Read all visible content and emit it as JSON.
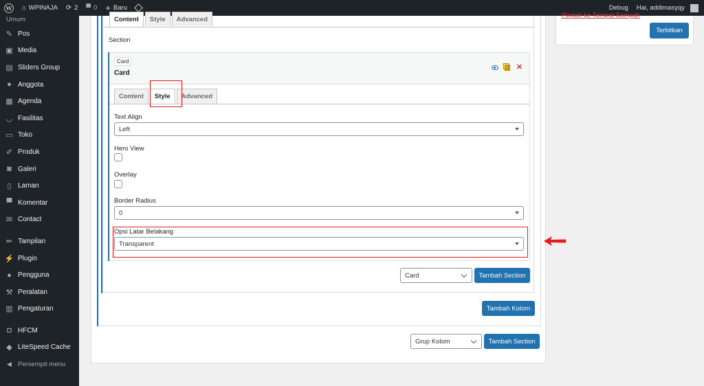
{
  "adminbar": {
    "wp_logo": "W",
    "site_name": "WPINAJA",
    "updates_count": "2",
    "comments_count": "0",
    "new_label": "Baru",
    "debug_label": "Debug",
    "greeting": "Hai, addimasyqy"
  },
  "sidebar": {
    "top_label": "Umum",
    "items": [
      {
        "label": "Pos",
        "icon": "pin-icon"
      },
      {
        "label": "Media",
        "icon": "media-icon"
      },
      {
        "label": "Sliders Group",
        "icon": "slider-icon"
      },
      {
        "label": "Anggota",
        "icon": "person-icon"
      },
      {
        "label": "Agenda",
        "icon": "calendar-icon"
      },
      {
        "label": "Fasilitas",
        "icon": "smile-icon"
      },
      {
        "label": "Toko",
        "icon": "store-icon"
      },
      {
        "label": "Produk",
        "icon": "product-icon"
      },
      {
        "label": "Galeri",
        "icon": "camera-icon"
      },
      {
        "label": "Laman",
        "icon": "page-icon"
      },
      {
        "label": "Komentar",
        "icon": "comment-icon"
      },
      {
        "label": "Contact",
        "icon": "mail-icon"
      }
    ],
    "items2": [
      {
        "label": "Tampilan",
        "icon": "brush-icon"
      },
      {
        "label": "Plugin",
        "icon": "plugin-icon"
      },
      {
        "label": "Pengguna",
        "icon": "users-icon"
      },
      {
        "label": "Peralatan",
        "icon": "wrench-icon"
      },
      {
        "label": "Pengaturan",
        "icon": "settings-icon"
      }
    ],
    "items3": [
      {
        "label": "HFCM",
        "icon": "robot-icon"
      },
      {
        "label": "LiteSpeed Cache",
        "icon": "diamond-icon"
      }
    ],
    "collapse_label": "Persempit menu"
  },
  "side_panel": {
    "trash_link": "Pindah ke Tempat Sampah",
    "publish_button": "Terbitkan"
  },
  "outer_tabs": [
    "Content",
    "Style",
    "Advanced"
  ],
  "section_label": "Section",
  "card": {
    "badge": "Card",
    "title": "Card",
    "tabs": [
      "Content",
      "Style",
      "Advanced"
    ],
    "fields": {
      "text_align": {
        "label": "Text Align",
        "value": "Left"
      },
      "hero_view": {
        "label": "Hero View"
      },
      "overlay": {
        "label": "Overlay"
      },
      "border_radius": {
        "label": "Border Radius",
        "value": "0"
      },
      "bg_option": {
        "label": "Opsi Latar Belakang",
        "value": "Transparent"
      }
    }
  },
  "section_footer": {
    "select_value": "Card",
    "add_section_button": "Tambah Section"
  },
  "column_footer": {
    "add_column_button": "Tambah Kolom"
  },
  "page_footer": {
    "select_value": "Grup Kolom",
    "add_section_button": "Tambah Section"
  },
  "colors": {
    "accent": "#2271b1",
    "highlight": "#e01e1e",
    "adminbar_bg": "#1d2327"
  }
}
